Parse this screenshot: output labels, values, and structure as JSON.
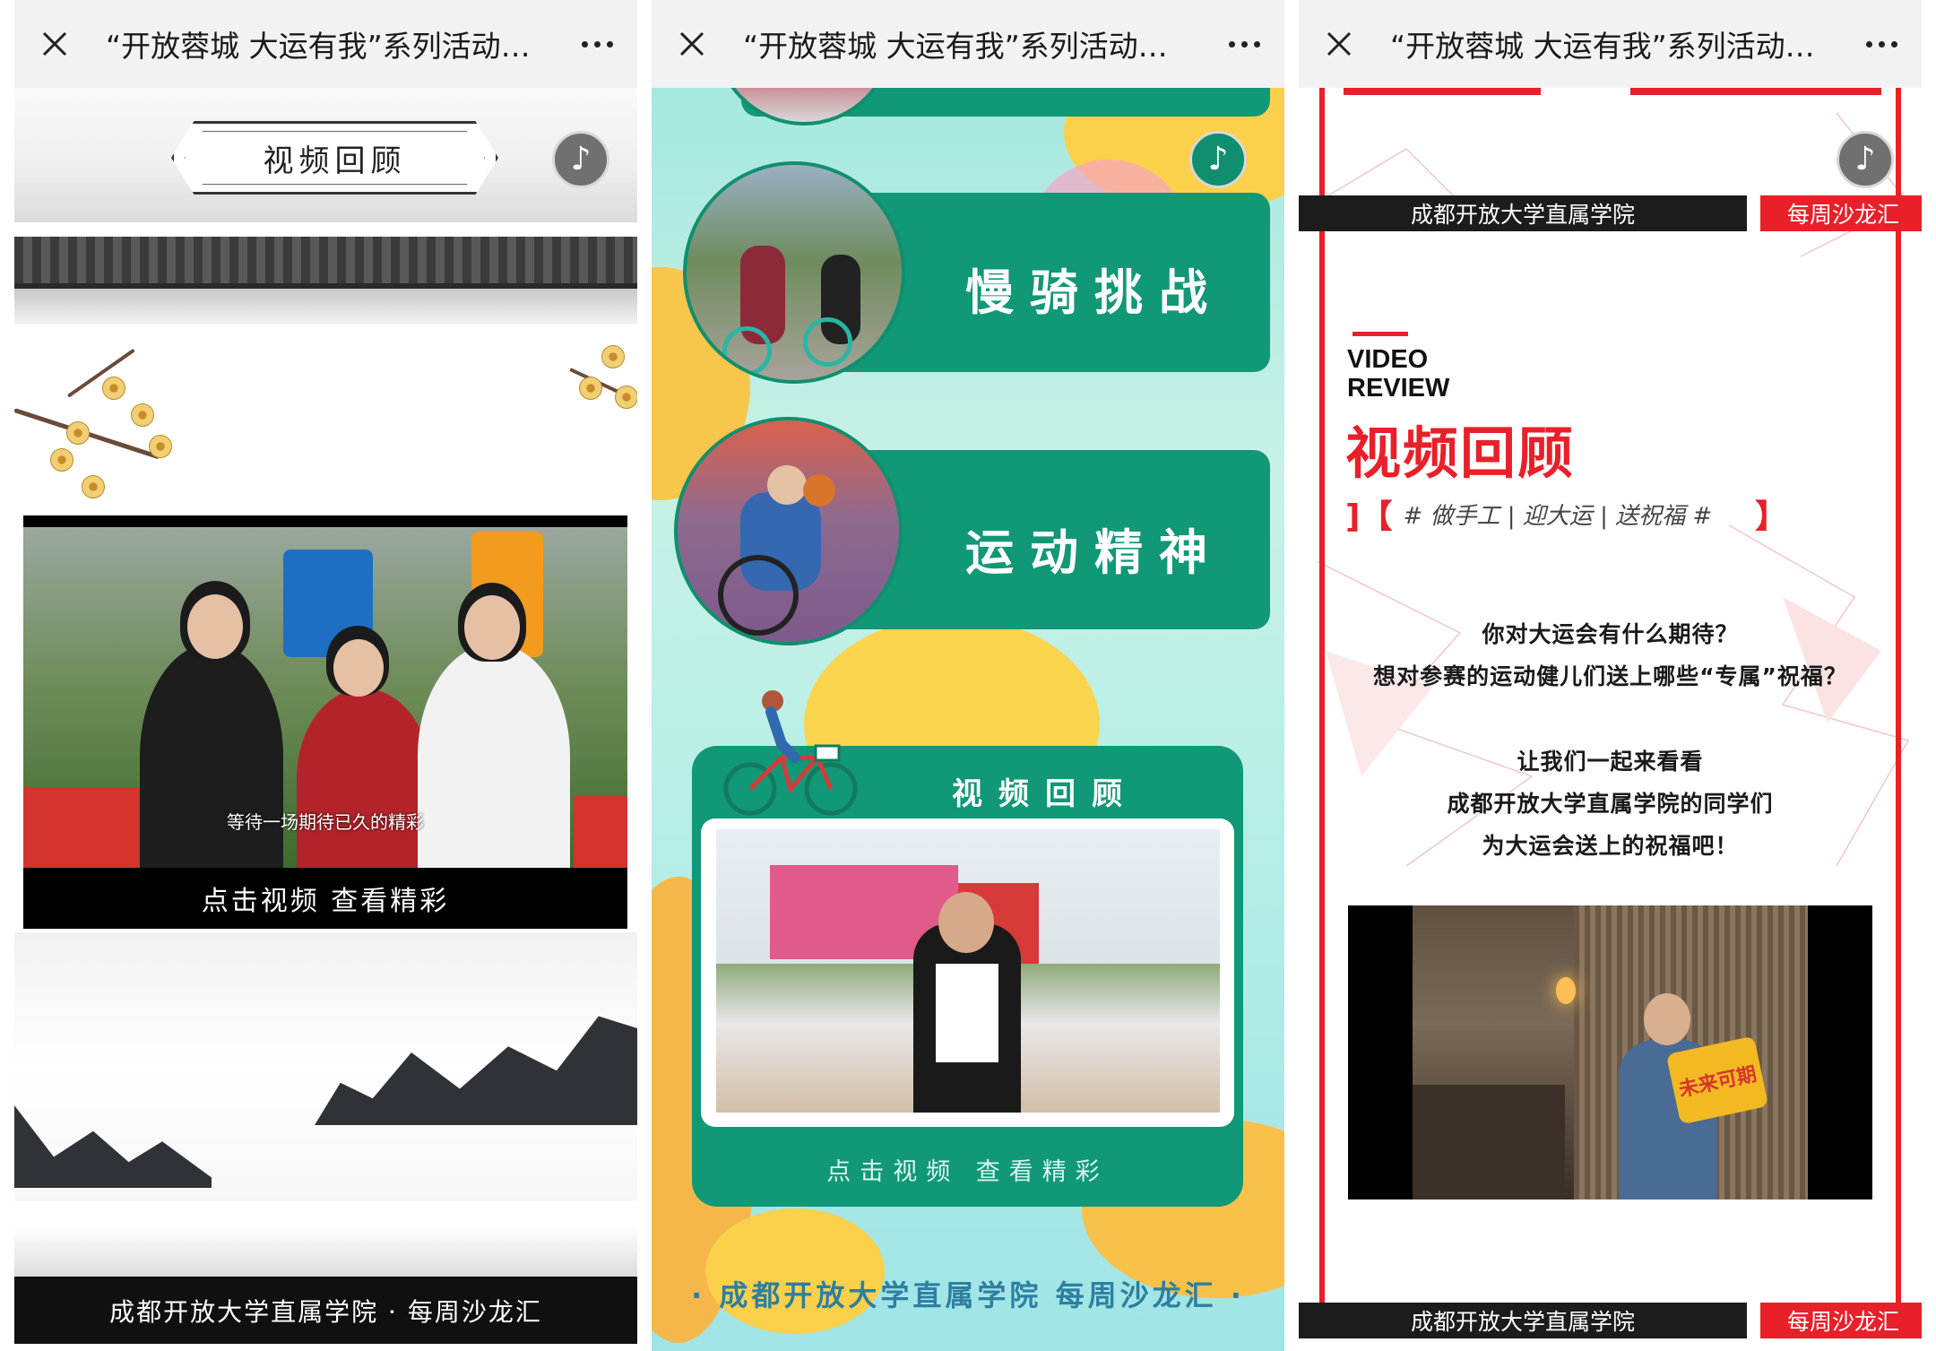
{
  "panels": [
    {
      "topbar": {
        "title": "“开放蓉城 大运有我”系列活动…"
      },
      "header": {
        "plaque": "视频回顾"
      },
      "video": {
        "subtitle": "等待一场期待已久的精彩",
        "caption": "点击视频 查看精彩"
      },
      "footer": {
        "text": "成都开放大学直属学院 · 每周沙龙汇"
      }
    },
    {
      "topbar": {
        "title": "“开放蓉城 大运有我”系列活动…"
      },
      "cards": [
        {
          "label": "慢骑挑战"
        },
        {
          "label": "运动精神"
        }
      ],
      "video": {
        "title": "视频回顾",
        "caption": "点击视频 查看精彩"
      },
      "footer": {
        "text": "· 成都开放大学直属学院 每周沙龙汇 ·"
      }
    },
    {
      "topbar": {
        "title": "“开放蓉城 大运有我”系列活动…"
      },
      "band": {
        "left": "成都开放大学直属学院",
        "right": "每周沙龙汇"
      },
      "heading": {
        "en_line1": "VIDEO",
        "en_line2": "REVIEW",
        "cn": "视频回顾"
      },
      "tagline": {
        "text": "# 做手工 | 迎大运 | 送祝福 #"
      },
      "paragraphs": [
        "你对大运会有什么期待？",
        "想对参赛的运动健儿们送上哪些“专属”祝福？",
        "让我们一起来看看",
        "成都开放大学直属学院的同学们",
        "为大运会送上的祝福吧！"
      ],
      "sign": {
        "text": "未来可期"
      },
      "bottom_band": {
        "left": "成都开放大学直属学院",
        "right": "每周沙龙汇"
      }
    }
  ],
  "icons": {
    "close": "close-icon",
    "more": "more-icon",
    "music": "music-note-icon"
  },
  "colors": {
    "teal_card": "#119876",
    "red_accent": "#e8202a",
    "topbar_bg": "#f2f2f2"
  }
}
